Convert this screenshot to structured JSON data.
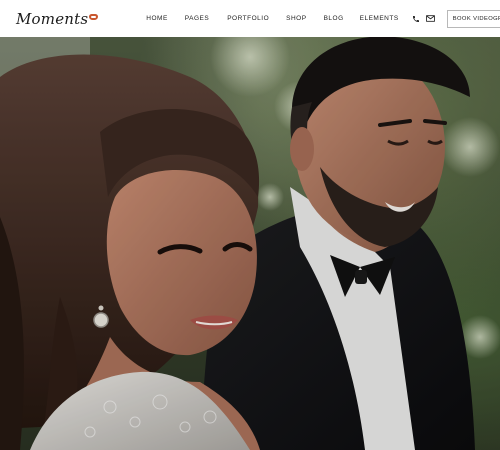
{
  "brand": {
    "logo_text": "Moments"
  },
  "nav": {
    "items": [
      {
        "label": "HOME"
      },
      {
        "label": "PAGES"
      },
      {
        "label": "PORTFOLIO"
      },
      {
        "label": "SHOP"
      },
      {
        "label": "BLOG"
      },
      {
        "label": "ELEMENTS"
      }
    ]
  },
  "header": {
    "cta_label": "BOOK VIDEOGRAPHER"
  },
  "icons": {
    "phone": "phone-icon",
    "mail": "mail-icon"
  },
  "colors": {
    "accent": "#c9572f",
    "header_bg": "#ffffff",
    "text": "#222222"
  }
}
